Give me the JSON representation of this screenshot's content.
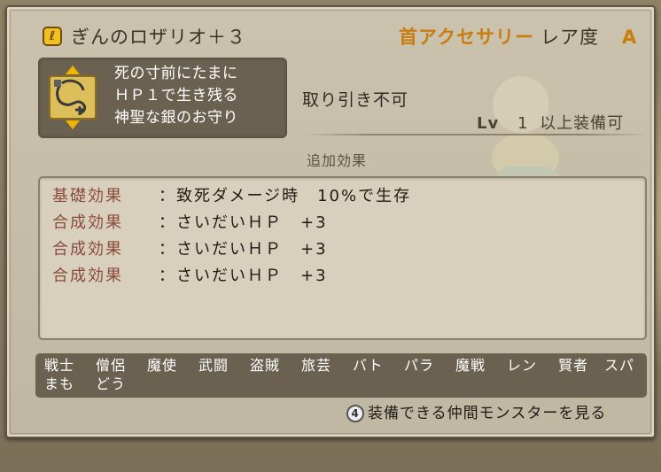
{
  "item": {
    "name": "ぎんのロザリオ＋３",
    "category": "首アクセサリー",
    "rarity_label": "レア度",
    "rarity_value": "A",
    "description": "死の寸前にたまに\nＨＰ１で生き残る\n神聖な銀のお守り",
    "trade": "取り引き不可",
    "level": {
      "prefix": "Lv",
      "value": "1",
      "suffix": "以上装備可"
    }
  },
  "effects": {
    "heading": "追加効果",
    "rows": [
      {
        "label": "基礎効果",
        "value": "：致死ダメージ時　10%で生存"
      },
      {
        "label": "合成効果",
        "value": "：さいだいＨＰ　+3"
      },
      {
        "label": "合成効果",
        "value": "：さいだいＨＰ　+3"
      },
      {
        "label": "合成効果",
        "value": "：さいだいＨＰ　+3"
      }
    ]
  },
  "jobs": {
    "line1": [
      "戦士",
      "僧侶",
      "魔使",
      "武闘",
      "盗賊",
      "旅芸",
      "バト",
      "パラ",
      "魔戦",
      "レン",
      "賢者",
      "スパ"
    ],
    "line2": [
      "まも",
      "どう"
    ]
  },
  "action": {
    "button_number": "4",
    "label": "装備できる仲間モンスターを見る"
  },
  "colors": {
    "accent_orange": "#c87d0f",
    "effect_label": "#8a4b3c",
    "panel_dark": "#6b6150"
  }
}
